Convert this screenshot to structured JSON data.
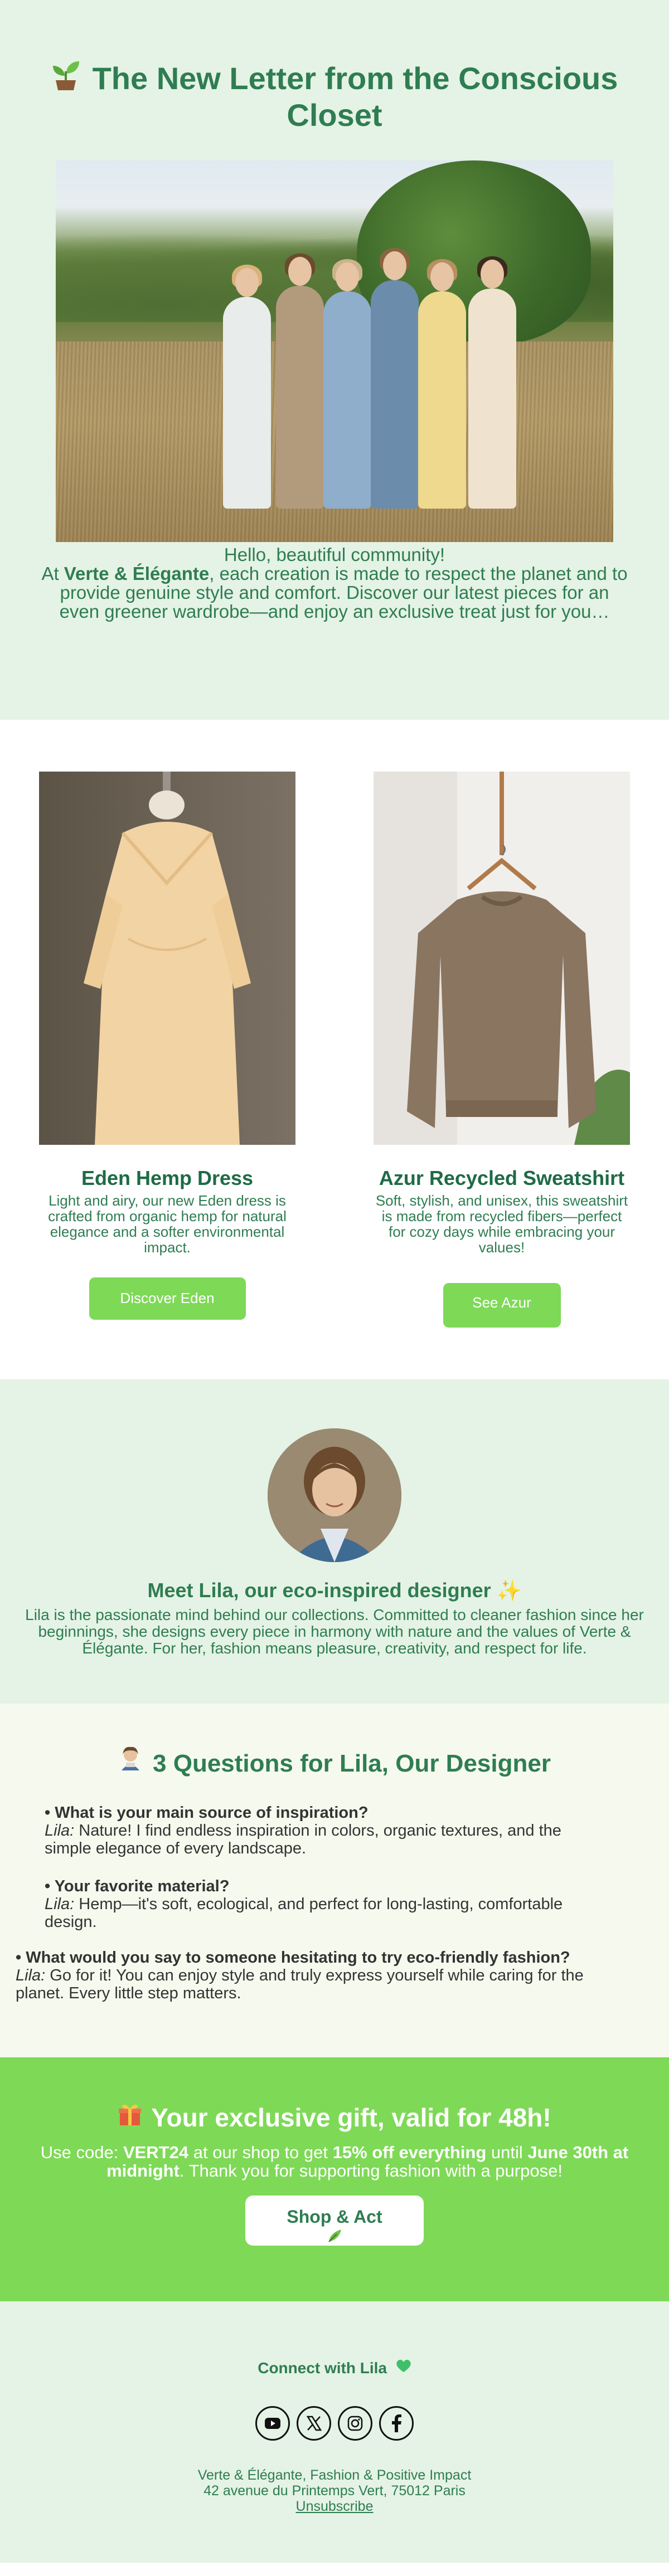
{
  "hero": {
    "title": "The New Letter from the Conscious Closet",
    "greeting": "Hello, beautiful community!",
    "intro_prefix": "At ",
    "brand": "Verte & Élégante",
    "intro_rest": ", each creation is made to respect the planet and to provide genuine style and comfort. Discover our latest pieces for an even greener wardrobe—and enjoy an exclusive treat just for you…",
    "image_icon": "sprout-icon"
  },
  "products": [
    {
      "title": "Eden Hemp Dress",
      "description": "Light and airy, our new Eden dress is crafted from organic hemp for natural elegance and a softer environmental impact.",
      "button": "Discover Eden"
    },
    {
      "title": "Azur Recycled Sweatshirt",
      "description": "Soft, stylish, and unisex, this sweatshirt is made from recycled fibers—perfect for cozy days while embracing your values!",
      "button": "See Azur"
    }
  ],
  "designer": {
    "title": "Meet Lila, our eco-inspired designer ✨",
    "bio": "Lila is the passionate mind behind our collections. Committed to cleaner fashion since her beginnings, she designs every piece in harmony with nature and the values of Verte & Élégante. For her, fashion means pleasure, creativity, and respect for life."
  },
  "qa": {
    "title": "3 Questions for Lila, Our Designer",
    "items": [
      {
        "question": "What is your main source of inspiration?",
        "speaker": "Lila:",
        "answer": " Nature! I find endless inspiration in colors, organic textures, and the simple elegance of every landscape."
      },
      {
        "question": "Your favorite material?",
        "speaker": "Lila:",
        "answer": " Hemp—it's soft, ecological, and perfect for long-lasting, comfortable design."
      },
      {
        "question": "What would you say to someone hesitating to try eco-friendly fashion?",
        "speaker": "Lila:",
        "answer": " Go for it! You can enjoy style and truly express yourself while caring for the planet. Every little step matters."
      }
    ]
  },
  "gift": {
    "title": "Your exclusive gift, valid for 48h!",
    "text_1": "Use code: ",
    "code": "VERT24",
    "text_2": " at our shop to get ",
    "discount": "15% off everything",
    "text_3": " until ",
    "deadline": "June 30th at midnight",
    "text_4": ". Thank you for supporting fashion with a purpose!",
    "button": "Shop & Act"
  },
  "footer": {
    "connect": "Connect with Lila",
    "socials": [
      "youtube-icon",
      "x-icon",
      "instagram-icon",
      "facebook-icon"
    ],
    "company": "Verte & Élégante, Fashion & Positive Impact",
    "address": "42 avenue du Printemps Vert, 75012 Paris",
    "unsubscribe": "Unsubscribe"
  },
  "colors": {
    "primary_green": "#2f7d52",
    "accent_green": "#7ed957",
    "light_bg": "#e4f3e5",
    "cream_bg": "#f6faee"
  }
}
